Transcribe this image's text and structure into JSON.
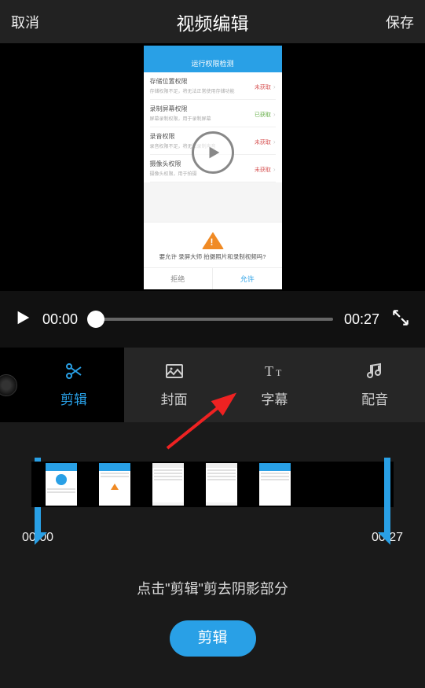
{
  "header": {
    "cancel": "取消",
    "title": "视频编辑",
    "save": "保存"
  },
  "preview": {
    "phone_title": "运行权限检测",
    "permissions": [
      {
        "title": "存储位置权限",
        "sub": "存储权限不足，将无法正常使用存储功能",
        "status": "未获取",
        "ok": false
      },
      {
        "title": "录制屏幕权限",
        "sub": "屏幕录制权限，用于录制屏幕",
        "status": "已获取",
        "ok": true
      },
      {
        "title": "录音权限",
        "sub": "录音权限不足，将无法录制声音",
        "status": "未获取",
        "ok": false
      },
      {
        "title": "摄像头权限",
        "sub": "摄像头权限，用于拍摄",
        "status": "未获取",
        "ok": false
      }
    ],
    "dialog_text": "要允许 录屏大师 拍摄照片和录制视频吗?",
    "dialog_deny": "拒绝",
    "dialog_allow": "允许"
  },
  "player": {
    "current": "00:00",
    "duration": "00:27"
  },
  "tabs": {
    "trim": "剪辑",
    "cover": "封面",
    "subtitle": "字幕",
    "audio": "配音"
  },
  "timeline": {
    "start": "00:00",
    "end": "00:27"
  },
  "hint": "点击\"剪辑\"剪去阴影部分",
  "action_button": "剪辑",
  "colors": {
    "accent": "#29a0e6"
  }
}
